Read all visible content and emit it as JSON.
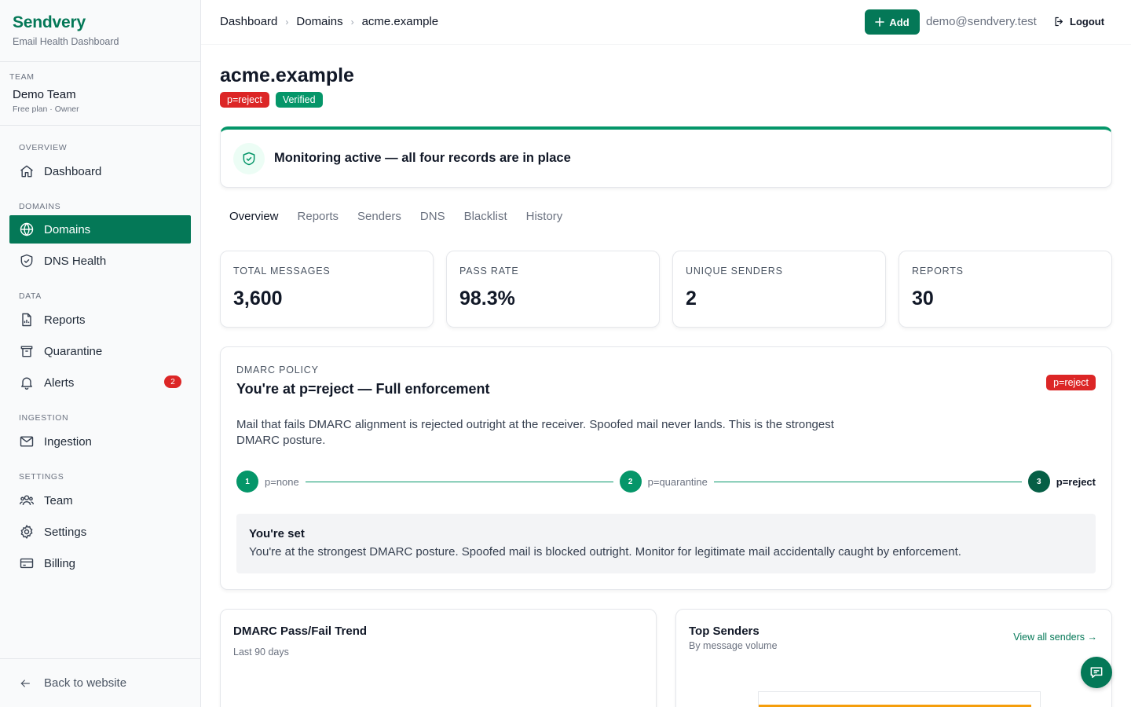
{
  "brand": {
    "name": "Sendvery",
    "subtitle": "Email Health Dashboard"
  },
  "team": {
    "label": "TEAM",
    "name": "Demo Team",
    "plan": "Free plan · Owner"
  },
  "sidebar": {
    "sections": [
      {
        "label": "OVERVIEW",
        "items": [
          {
            "label": "Dashboard",
            "icon": "home-icon"
          }
        ]
      },
      {
        "label": "DOMAINS",
        "items": [
          {
            "label": "Domains",
            "icon": "globe-icon",
            "active": true
          },
          {
            "label": "DNS Health",
            "icon": "shield-icon"
          }
        ]
      },
      {
        "label": "DATA",
        "items": [
          {
            "label": "Reports",
            "icon": "document-chart-icon"
          },
          {
            "label": "Quarantine",
            "icon": "trash-icon"
          },
          {
            "label": "Alerts",
            "icon": "bell-icon",
            "badge": "2"
          }
        ]
      },
      {
        "label": "INGESTION",
        "items": [
          {
            "label": "Ingestion",
            "icon": "envelope-icon"
          }
        ]
      },
      {
        "label": "SETTINGS",
        "items": [
          {
            "label": "Team",
            "icon": "users-icon"
          },
          {
            "label": "Settings",
            "icon": "gear-icon"
          },
          {
            "label": "Billing",
            "icon": "credit-card-icon"
          }
        ]
      }
    ],
    "back": "Back to website"
  },
  "header": {
    "breadcrumbs": [
      "Dashboard",
      "Domains",
      "acme.example"
    ],
    "add_label": "Add",
    "user_email": "demo@sendvery.test",
    "logout_label": "Logout"
  },
  "page": {
    "title": "acme.example",
    "badges": {
      "policy": "p=reject",
      "verified": "Verified"
    }
  },
  "status": {
    "text": "Monitoring active — all four records are in place"
  },
  "tabs": [
    "Overview",
    "Reports",
    "Senders",
    "DNS",
    "Blacklist",
    "History"
  ],
  "stats": [
    {
      "label": "TOTAL MESSAGES",
      "value": "3,600"
    },
    {
      "label": "PASS RATE",
      "value": "98.3%"
    },
    {
      "label": "UNIQUE SENDERS",
      "value": "2"
    },
    {
      "label": "REPORTS",
      "value": "30"
    }
  ],
  "policy": {
    "label": "DMARC POLICY",
    "title": "You're at p=reject — Full enforcement",
    "badge": "p=reject",
    "description": "Mail that fails DMARC alignment is rejected outright at the receiver. Spoofed mail never lands. This is the strongest DMARC posture.",
    "steps": [
      {
        "num": "1",
        "label": "p=none"
      },
      {
        "num": "2",
        "label": "p=quarantine"
      },
      {
        "num": "3",
        "label": "p=reject"
      }
    ],
    "set_title": "You're set",
    "set_text": "You're at the strongest DMARC posture. Spoofed mail is blocked outright. Monitor for legitimate mail accidentally caught by enforcement."
  },
  "trend": {
    "title": "DMARC Pass/Fail Trend",
    "subtitle": "Last 90 days"
  },
  "senders": {
    "title": "Top Senders",
    "subtitle": "By message volume",
    "view_all": "View all senders →",
    "bar_fraction": 0.97
  },
  "colors": {
    "brand": "#047857",
    "success": "#059669",
    "danger": "#dc2626",
    "bar": "#f59e0b"
  }
}
